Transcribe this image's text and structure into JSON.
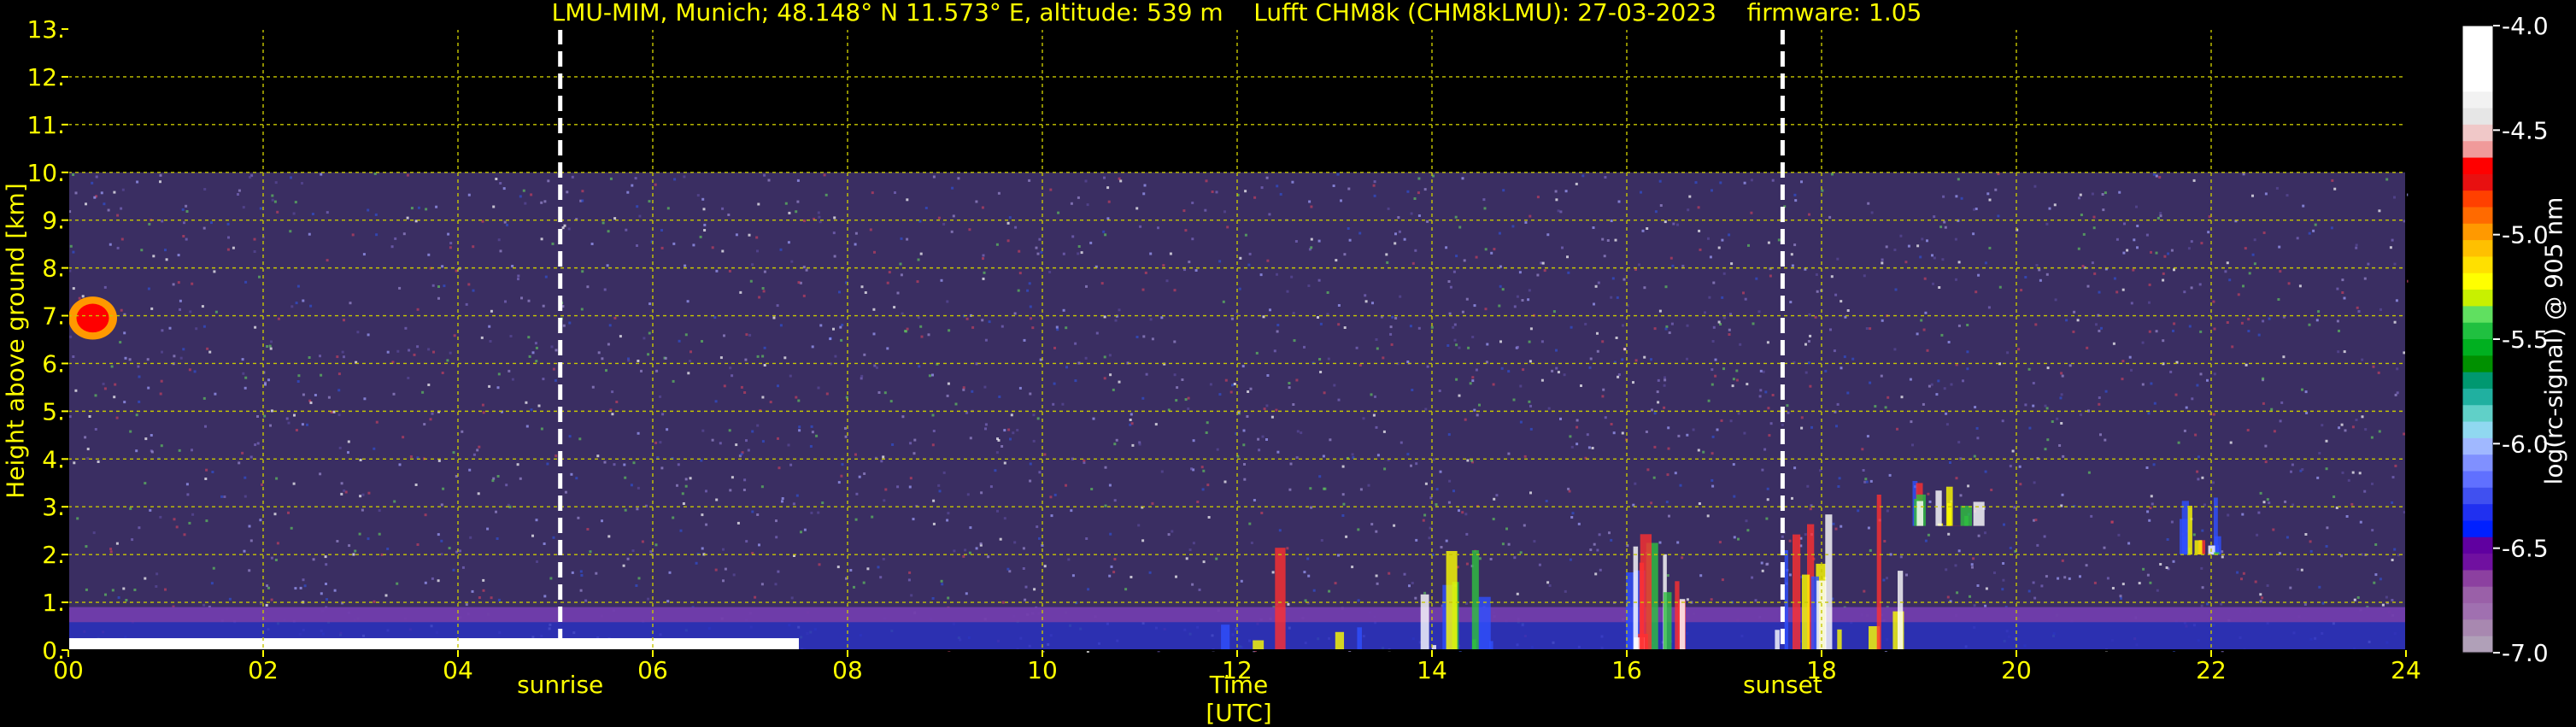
{
  "title": "LMU-MIM, Munich; 48.148° N 11.573° E, altitude: 539 m    Lufft CHM8k (CHM8kLMU): 27-03-2023    firmware: 1.05",
  "colors": {
    "axis_text": "#ffff00",
    "grid": "#c8c800",
    "background": "#000000",
    "marker": "#ffffff"
  },
  "chart_data": {
    "type": "heatmap",
    "title": "LMU-MIM, Munich; 48.148° N 11.573° E, altitude: 539 m    Lufft CHM8k (CHM8kLMU): 27-03-2023    firmware: 1.05",
    "xlabel": "Time [UTC]",
    "ylabel": "Height above ground [km]",
    "colorbar_label": "log(rc-signal) @ 905 nm",
    "xlim": [
      0,
      24
    ],
    "ylim": [
      0,
      13
    ],
    "clim": [
      -7.0,
      -4.0
    ],
    "x_ticks": [
      "00",
      "02",
      "04",
      "06",
      "08",
      "10",
      "12",
      "14",
      "16",
      "18",
      "20",
      "22",
      "24"
    ],
    "x_tick_values": [
      0,
      2,
      4,
      6,
      8,
      10,
      12,
      14,
      16,
      18,
      20,
      22,
      24
    ],
    "y_ticks": [
      "0.",
      "1.",
      "2.",
      "3.",
      "4.",
      "5.",
      "6.",
      "7.",
      "8.",
      "9.",
      "10.",
      "11.",
      "12.",
      "13."
    ],
    "y_tick_values": [
      0,
      1,
      2,
      3,
      4,
      5,
      6,
      7,
      8,
      9,
      10,
      11,
      12,
      13
    ],
    "colorbar_ticks": [
      "-4.0",
      "-4.5",
      "-5.0",
      "-5.5",
      "-6.0",
      "-6.5",
      "-7.0"
    ],
    "colorbar_tick_values": [
      -4.0,
      -4.5,
      -5.0,
      -5.5,
      -6.0,
      -6.5,
      -7.0
    ],
    "colorbar_colors": [
      "#ffffff",
      "#ffffff",
      "#ffffff",
      "#ffffff",
      "#f2f2f2",
      "#e6e6e6",
      "#f0c8c8",
      "#f09a9a",
      "#ff0000",
      "#e81010",
      "#ff4000",
      "#ff6a00",
      "#ff9900",
      "#ffc000",
      "#ffe000",
      "#ffff00",
      "#c8f000",
      "#60e060",
      "#20c040",
      "#00b020",
      "#009000",
      "#009870",
      "#20b0a0",
      "#60d0c8",
      "#90d8f0",
      "#a0b8ff",
      "#8090ff",
      "#6070ff",
      "#4050f0",
      "#2030f0",
      "#0020ff",
      "#6000a0",
      "#7010a0",
      "#8c40a0",
      "#9a60a8",
      "#a070b0",
      "#a888b0",
      "#b0a0b8"
    ],
    "grid": true,
    "vertical_markers": [
      {
        "label": "sunrise",
        "x": 5.05
      },
      {
        "label": "sunset",
        "x": 17.6
      }
    ],
    "signal_ceiling_km": 10.0,
    "features": [
      {
        "name": "aerosol-layer",
        "t_start": 0.0,
        "t_end": 24.0,
        "h_bottom": 0.0,
        "h_top": 0.9,
        "value": -6.3
      },
      {
        "name": "boundary-layer",
        "t_start": 0.0,
        "t_end": 7.5,
        "h_bottom": 0.0,
        "h_top": 0.25,
        "value": -4.2
      },
      {
        "name": "elevated-cloud",
        "t_start": 0.0,
        "t_end": 0.5,
        "h_bottom": 6.5,
        "h_top": 7.4,
        "value": -5.0
      },
      {
        "name": "cloud-cluster",
        "t_start": 11.8,
        "t_end": 14.8,
        "h_bottom": 0.0,
        "h_top": 2.4,
        "value": -4.5
      },
      {
        "name": "cloud-cluster",
        "t_start": 15.9,
        "t_end": 16.6,
        "h_bottom": 0.0,
        "h_top": 3.0,
        "value": -4.5
      },
      {
        "name": "cloud-cluster",
        "t_start": 17.0,
        "t_end": 18.8,
        "h_bottom": 0.0,
        "h_top": 3.9,
        "value": -4.5
      },
      {
        "name": "cloud-cluster",
        "t_start": 18.9,
        "t_end": 19.6,
        "h_bottom": 2.6,
        "h_top": 3.7,
        "value": -4.8
      },
      {
        "name": "cloud-cluster",
        "t_start": 21.6,
        "t_end": 22.1,
        "h_bottom": 2.0,
        "h_top": 3.4,
        "value": -4.8
      }
    ]
  }
}
